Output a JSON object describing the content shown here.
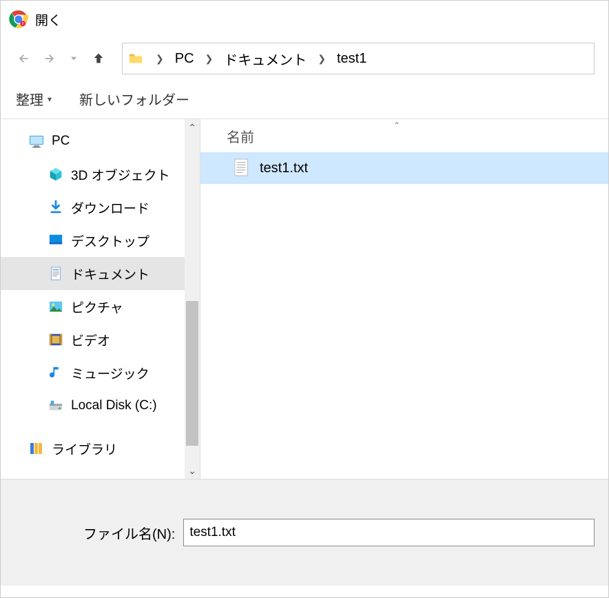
{
  "window": {
    "title": "開く"
  },
  "breadcrumbs": {
    "seg0": "PC",
    "seg1": "ドキュメント",
    "seg2": "test1"
  },
  "toolbar": {
    "organize": "整理",
    "new_folder": "新しいフォルダー"
  },
  "sidebar": {
    "pc": "PC",
    "items": {
      "objects3d": "3D オブジェクト",
      "downloads": "ダウンロード",
      "desktop": "デスクトップ",
      "documents": "ドキュメント",
      "pictures": "ピクチャ",
      "videos": "ビデオ",
      "music": "ミュージック",
      "localdisk": "Local Disk (C:)"
    },
    "libraries": "ライブラリ"
  },
  "filelist": {
    "header_name": "名前",
    "file0": "test1.txt"
  },
  "footer": {
    "filename_label": "ファイル名(N):",
    "filename_value": "test1.txt"
  }
}
